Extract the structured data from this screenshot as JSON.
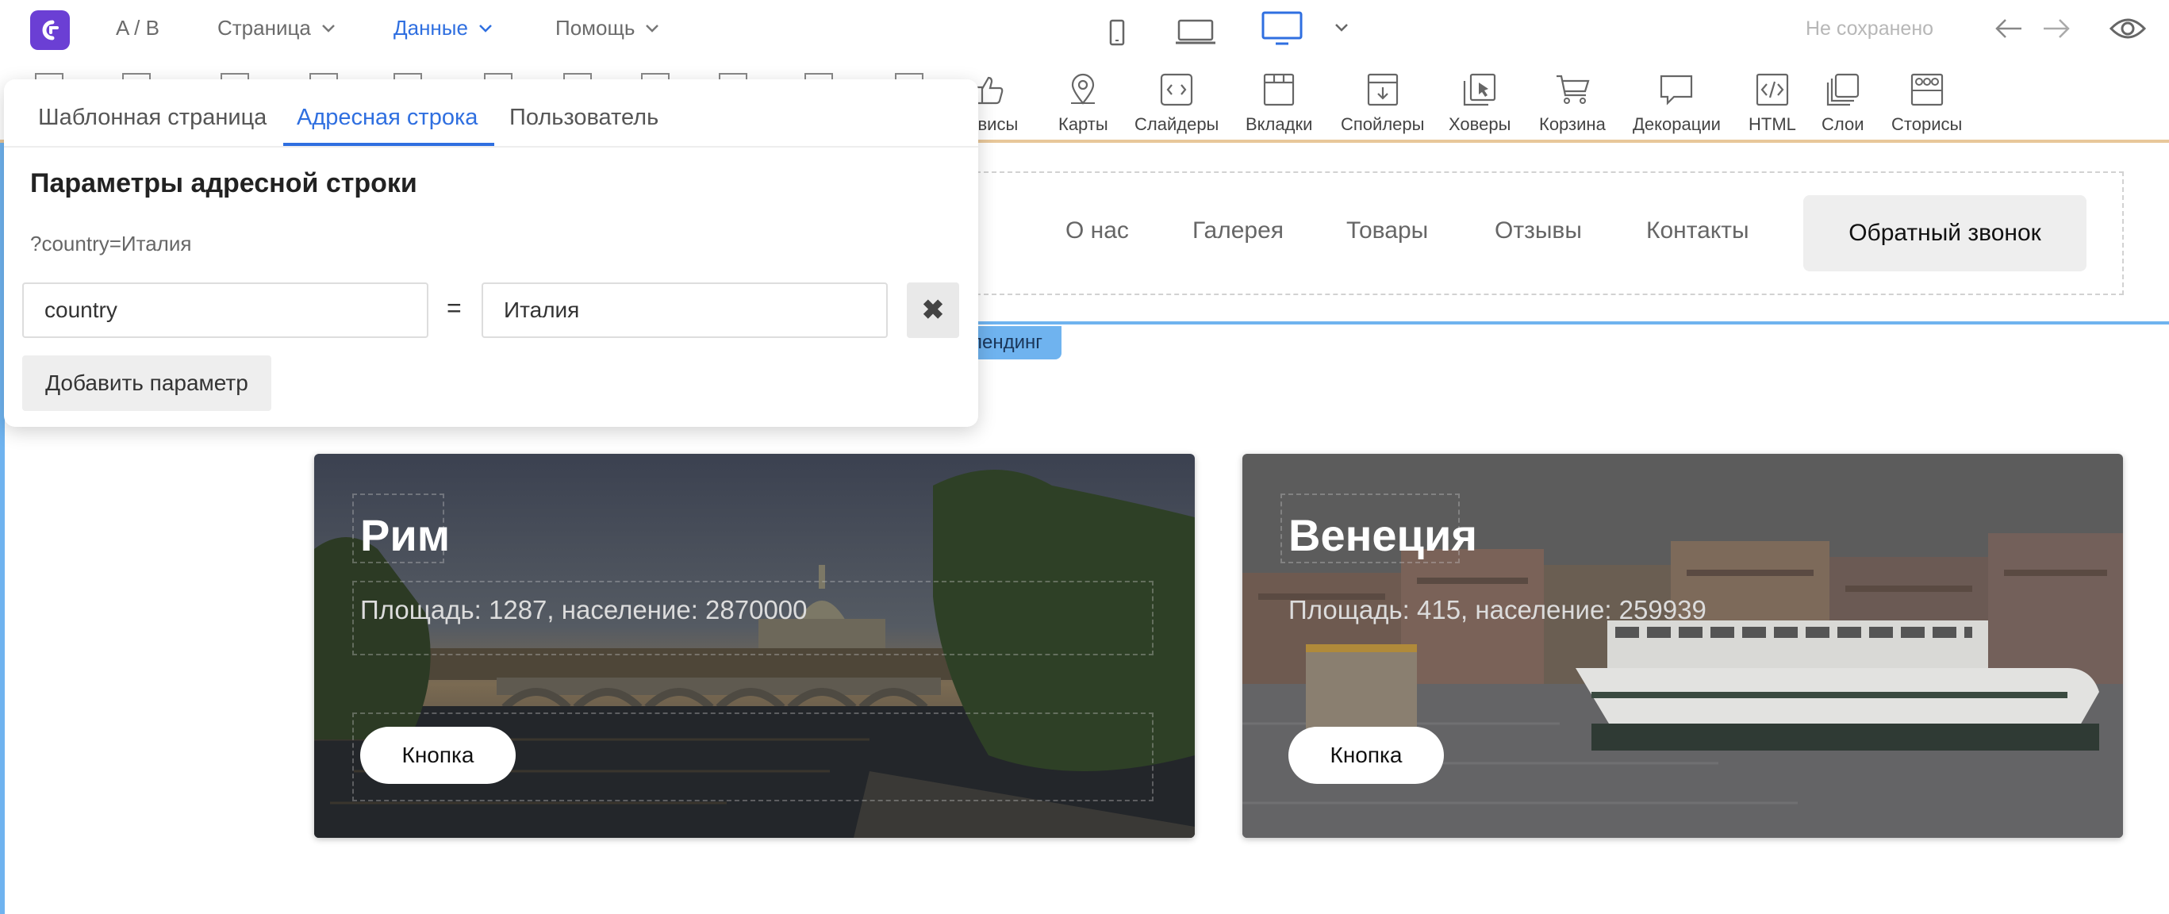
{
  "topbar": {
    "ab_label": "A / B",
    "menus": [
      {
        "label": "Страница"
      },
      {
        "label": "Данные"
      },
      {
        "label": "Помощь"
      }
    ],
    "save_status": "Не сохранено"
  },
  "widgets": [
    {
      "label": "ервисы",
      "icon": "thumbs-up-icon"
    },
    {
      "label": "Карты",
      "icon": "map-pin-icon"
    },
    {
      "label": "Слайдеры",
      "icon": "slider-icon"
    },
    {
      "label": "Вкладки",
      "icon": "tabs-icon"
    },
    {
      "label": "Спойлеры",
      "icon": "spoiler-icon"
    },
    {
      "label": "Ховеры",
      "icon": "hover-icon"
    },
    {
      "label": "Корзина",
      "icon": "cart-icon"
    },
    {
      "label": "Декорации",
      "icon": "speech-bubble-icon"
    },
    {
      "label": "HTML",
      "icon": "html-icon"
    },
    {
      "label": "Слои",
      "icon": "layers-icon"
    },
    {
      "label": "Сторисы",
      "icon": "stories-icon"
    }
  ],
  "site_header": {
    "menu": [
      "О нас",
      "Галерея",
      "Товары",
      "Отзывы",
      "Контакты"
    ],
    "cta": "Обратный звонок"
  },
  "block_tag": "лендинг",
  "cards": [
    {
      "title": "Рим",
      "subtitle": "Площадь: 1287, население: 2870000",
      "button": "Кнопка"
    },
    {
      "title": "Венеция",
      "subtitle": "Площадь: 415, население: 259939",
      "button": "Кнопка"
    }
  ],
  "panel": {
    "tabs": [
      "Шаблонная страница",
      "Адресная строка",
      "Пользователь"
    ],
    "active_tab": "Адресная строка",
    "title": "Параметры адресной строки",
    "query_preview": "?country=Италия",
    "param_key": "country",
    "equals": "=",
    "param_value": "Италия",
    "remove_symbol": "✖",
    "add_button": "Добавить параметр"
  },
  "colors": {
    "accent": "#2f6fe0",
    "logo": "#6b3fd4",
    "guide": "#6fb3ef"
  }
}
